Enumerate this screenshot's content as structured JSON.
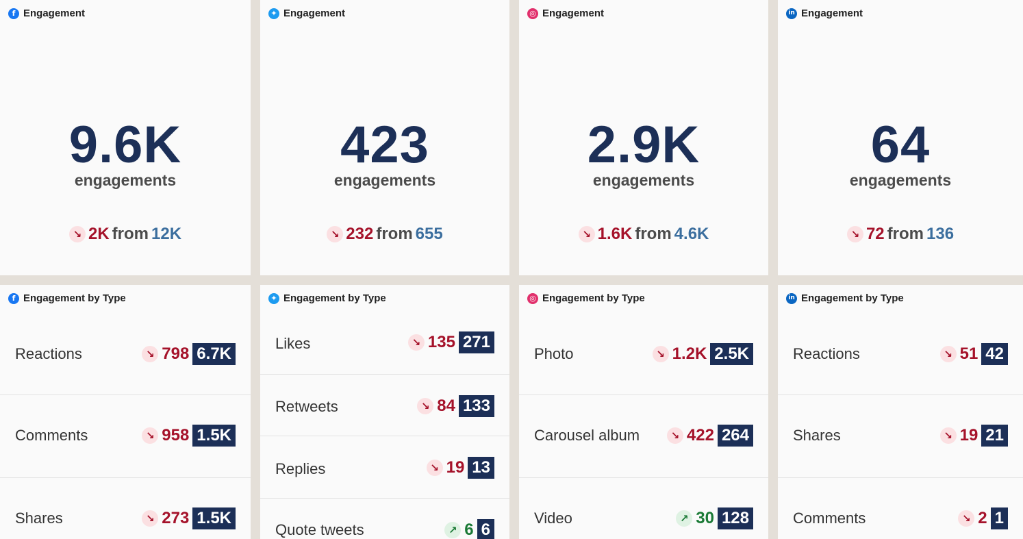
{
  "top_cards": [
    {
      "network": "facebook",
      "icon": "facebook-icon",
      "title": "Engagement",
      "value": "9.6K",
      "label": "engagements",
      "delta": "2K",
      "direction": "down",
      "from_word": "from",
      "previous": "12K"
    },
    {
      "network": "twitter",
      "icon": "twitter-icon",
      "title": "Engagement",
      "value": "423",
      "label": "engagements",
      "delta": "232",
      "direction": "down",
      "from_word": "from",
      "previous": "655"
    },
    {
      "network": "instagram",
      "icon": "instagram-icon",
      "title": "Engagement",
      "value": "2.9K",
      "label": "engagements",
      "delta": "1.6K",
      "direction": "down",
      "from_word": "from",
      "previous": "4.6K"
    },
    {
      "network": "linkedin",
      "icon": "linkedin-icon",
      "title": "Engagement",
      "value": "64",
      "label": "engagements",
      "delta": "72",
      "direction": "down",
      "from_word": "from",
      "previous": "136"
    }
  ],
  "type_cards": [
    {
      "network": "facebook",
      "title": "Engagement by Type",
      "rows": [
        {
          "label": "Reactions",
          "delta": "798",
          "direction": "down",
          "current": "6.7K"
        },
        {
          "label": "Comments",
          "delta": "958",
          "direction": "down",
          "current": "1.5K"
        },
        {
          "label": "Shares",
          "delta": "273",
          "direction": "down",
          "current": "1.5K"
        }
      ]
    },
    {
      "network": "twitter",
      "title": "Engagement by Type",
      "rows": [
        {
          "label": "Likes",
          "delta": "135",
          "direction": "down",
          "current": "271"
        },
        {
          "label": "Retweets",
          "delta": "84",
          "direction": "down",
          "current": "133"
        },
        {
          "label": "Replies",
          "delta": "19",
          "direction": "down",
          "current": "13"
        },
        {
          "label": "Quote tweets",
          "delta": "6",
          "direction": "up",
          "current": "6"
        }
      ]
    },
    {
      "network": "instagram",
      "title": "Engagement by Type",
      "rows": [
        {
          "label": "Photo",
          "delta": "1.2K",
          "direction": "down",
          "current": "2.5K"
        },
        {
          "label": "Carousel album",
          "delta": "422",
          "direction": "down",
          "current": "264"
        },
        {
          "label": "Video",
          "delta": "30",
          "direction": "up",
          "current": "128"
        }
      ]
    },
    {
      "network": "linkedin",
      "title": "Engagement by Type",
      "rows": [
        {
          "label": "Reactions",
          "delta": "51",
          "direction": "down",
          "current": "42"
        },
        {
          "label": "Shares",
          "delta": "19",
          "direction": "down",
          "current": "21"
        },
        {
          "label": "Comments",
          "delta": "2",
          "direction": "down",
          "current": "1"
        }
      ]
    }
  ],
  "colors": {
    "navy": "#1c2f57",
    "down": "#a5122a",
    "up": "#1b7a36",
    "previous": "#3b6e9e",
    "background": "#e4dfd8"
  }
}
